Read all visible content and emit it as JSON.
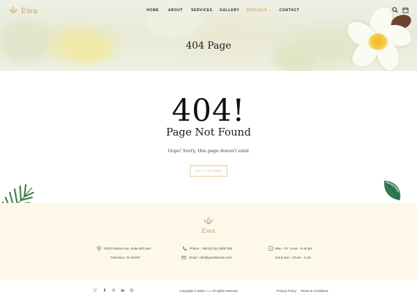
{
  "brand": {
    "name": "Ewa",
    "accent": "#d9a556",
    "logo_color": "#c9a36b"
  },
  "nav": {
    "items": [
      {
        "label": "HOME"
      },
      {
        "label": "ABOUT"
      },
      {
        "label": "SERVICES"
      },
      {
        "label": "GALLERY"
      },
      {
        "label": "SPECIALS",
        "active": true,
        "caret": "⌄"
      },
      {
        "label": "CONTACT"
      }
    ],
    "icons": [
      "search-icon",
      "calendar-icon"
    ]
  },
  "hero": {
    "title": "404 Page"
  },
  "main": {
    "code": "404!",
    "heading": "Page Not Found",
    "message": "Oops! Sorry, this page doesn't exist",
    "button_label": "BACK TO HOME"
  },
  "footer": {
    "brand": "Ewa",
    "address_line1": "75/23 Folsom Ave, Suite 600 San",
    "address_line2": "Francisco, CA 94107",
    "phone": "Phone : +88 (0) 101 0000 000",
    "email": "Email : info@yourdomain.com",
    "hours_line1": "Mon - Fri : 8 am - 9.30 pm",
    "hours_line2": "Sat & Sun : 10 am - 1 pm",
    "socials": [
      "twitter-icon",
      "facebook-icon",
      "pinterest-icon",
      "linkedin-icon",
      "instagram-icon"
    ],
    "copyright_prefix": "Copyright © 2020",
    "copyright_brand": "Ewa",
    "copyright_suffix": "All rights reserved",
    "privacy": "Privacy Policy",
    "terms": "Terms & Conditions"
  }
}
